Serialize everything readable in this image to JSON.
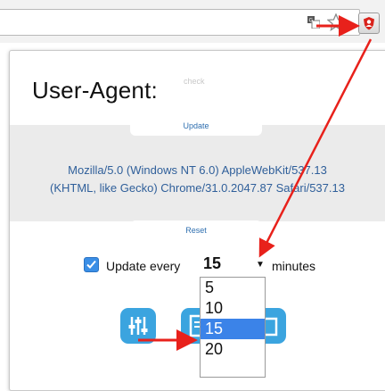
{
  "popup": {
    "title": "User-Agent:",
    "check_link": "check",
    "update_button": "Update",
    "reset_button": "Reset",
    "user_agent_lines": [
      "Mozilla/5.0 (Windows NT 6.0) AppleWebKit/537.13",
      "(KHTML, like Gecko) Chrome/31.0.2047.87 Safari/537.13"
    ],
    "auto_update": {
      "checked": true,
      "label": "Update every",
      "interval": "15",
      "unit": "minutes",
      "options": [
        "5",
        "10",
        "15",
        "20"
      ],
      "selected_index": 2
    }
  },
  "toolbar": {
    "icons": [
      "translate-icon",
      "star-icon",
      "extension-icon"
    ]
  },
  "colors": {
    "accent": "#3ba4df",
    "arrow": "#e8211b",
    "link": "#2f6fb0",
    "band": "#ebebeb",
    "selected": "#3b83e8"
  }
}
